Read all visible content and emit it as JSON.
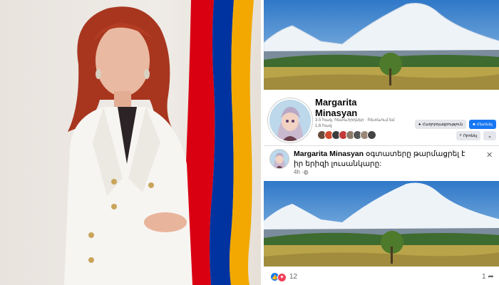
{
  "profile": {
    "name_line1": "Margarita",
    "name_line2": "Minasyan",
    "meta_line1": "3.5 հազ․ հետևորդներ · հետևում եմ",
    "meta_line2": "1,6 հազ",
    "message_button": "Հաղորդագրություն",
    "follow_button": "Հետևել",
    "search_button": "Որոնել",
    "more_button": "⌄"
  },
  "post": {
    "author": "Margarita Minasyan",
    "text": " օգտատերը թարմացրել է իր երիզի լուսանկարը:",
    "time": "4h",
    "close": "✕"
  },
  "reactions": {
    "count": "12",
    "shares": "1",
    "share_icon": "➦"
  },
  "colors": {
    "facebook_blue": "#1877f2",
    "love_red": "#f33e58",
    "flag_red": "#d90012",
    "flag_blue": "#0033a0",
    "flag_orange": "#f2a800"
  },
  "icons": [
    "messenger-icon",
    "follow-icon",
    "search-icon",
    "chevron-down-icon",
    "globe-icon",
    "like-icon",
    "love-icon",
    "share-icon",
    "close-icon"
  ]
}
